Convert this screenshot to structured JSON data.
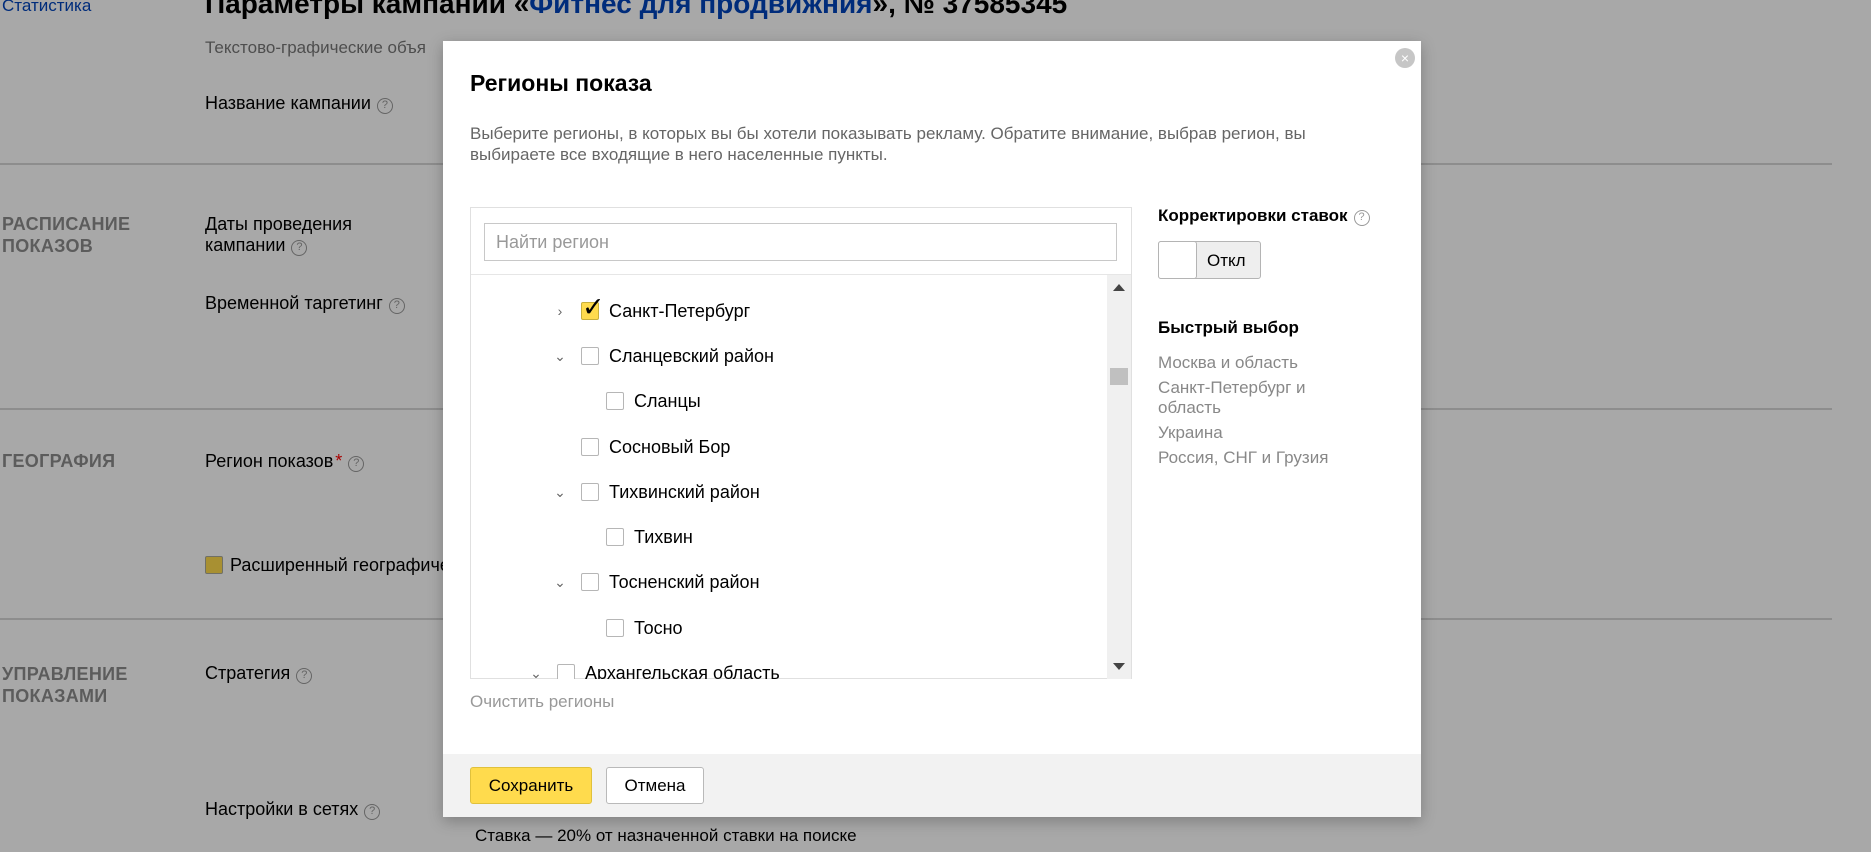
{
  "background": {
    "stats_link": "Статистика",
    "page_title_prefix": "Параметры кампании «",
    "page_title_campaign": "Фитнес для продвижния",
    "page_title_suffix": "», № 37585345",
    "subtitle": "Текстово-графические объя",
    "campaign_name_label": "Название кампании",
    "sections": {
      "schedule": "РАСПИСАНИЕ\nПОКАЗОВ",
      "geo": "ГЕОГРАФИЯ",
      "management": "УПРАВЛЕНИЕ\nПОКАЗАМИ"
    },
    "dates_label_1": "Даты проведения",
    "dates_label_2": "кампании",
    "time_targeting_label": "Временной таргетинг",
    "region_label": "Регион показов",
    "required_mark": "*",
    "extended_geo_label": "Расширенный географиче",
    "strategy_label": "Стратегия",
    "network_settings_label": "Настройки в сетях",
    "bid_note": "Ставка — 20% от назначенной ставки на поиске",
    "help_glyph": "?"
  },
  "modal": {
    "title": "Регионы показа",
    "description": "Выберите регионы, в которых вы бы хотели показывать рекламу. Обратите внимание, выбрав регион, вы выбираете все входящие в него населенные пункты.",
    "close_glyph": "×",
    "search": {
      "placeholder": "Найти регион",
      "value": ""
    },
    "tree": [
      {
        "label": "Санкт-Петербург",
        "checked": true,
        "expander": "collapsed",
        "level": 2
      },
      {
        "label": "Сланцевский район",
        "checked": false,
        "expander": "expanded",
        "level": 2
      },
      {
        "label": "Сланцы",
        "checked": false,
        "expander": "none",
        "level": 3
      },
      {
        "label": "Сосновый Бор",
        "checked": false,
        "expander": "none",
        "level": 2
      },
      {
        "label": "Тихвинский район",
        "checked": false,
        "expander": "expanded",
        "level": 2
      },
      {
        "label": "Тихвин",
        "checked": false,
        "expander": "none",
        "level": 3
      },
      {
        "label": "Тосненский район",
        "checked": false,
        "expander": "expanded",
        "level": 2
      },
      {
        "label": "Тосно",
        "checked": false,
        "expander": "none",
        "level": 3
      },
      {
        "label": "Архангельская область",
        "checked": false,
        "expander": "expanded",
        "level": 1
      }
    ],
    "clear_regions": "Очистить регионы",
    "bid_adjustments": {
      "title": "Корректировки ставок",
      "toggle_label": "Откл",
      "enabled": false
    },
    "quick_select": {
      "title": "Быстрый выбор",
      "items": [
        "Москва и область",
        "Санкт-Петербург и область",
        "Украина",
        "Россия, СНГ и Грузия"
      ]
    },
    "buttons": {
      "save": "Сохранить",
      "cancel": "Отмена"
    },
    "colors": {
      "accent": "#ffdb4d",
      "link": "#0044bb"
    }
  }
}
